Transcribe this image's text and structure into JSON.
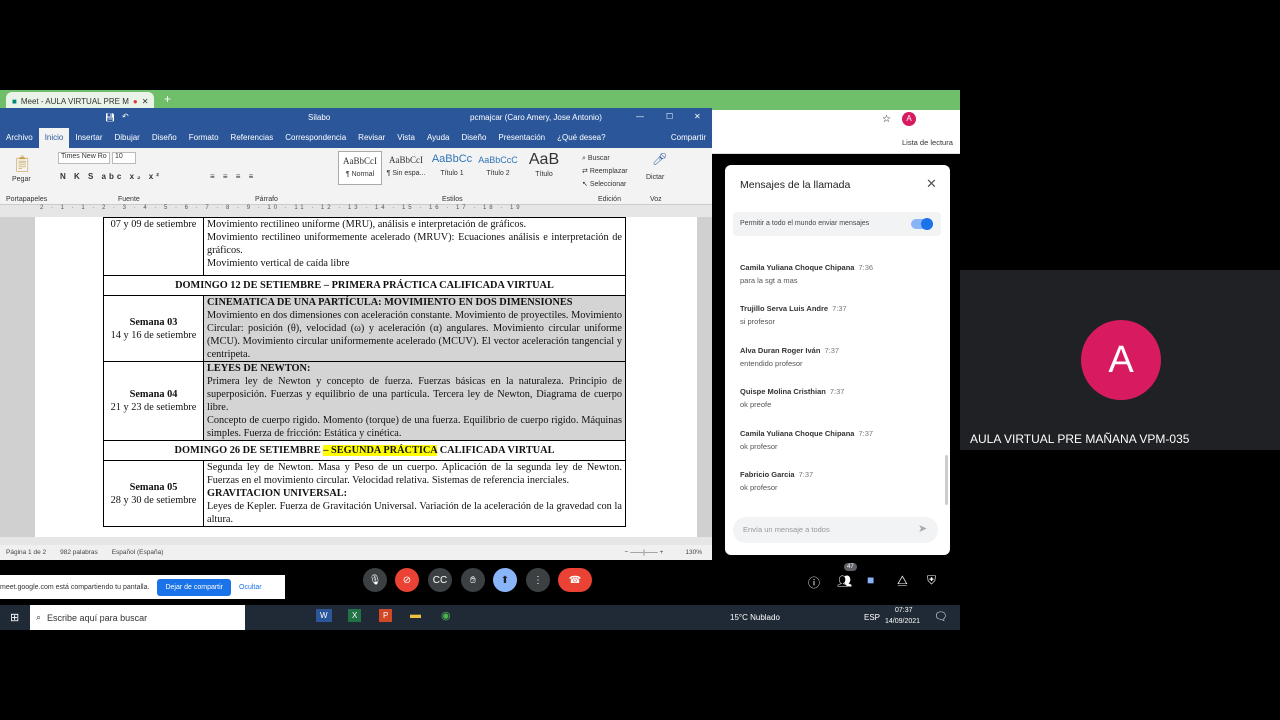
{
  "chrome": {
    "tab_title": "Meet - AULA VIRTUAL PRE M",
    "new_tab": "+",
    "reading_list": "Lista de lectura",
    "avatar_letter": "A"
  },
  "word": {
    "title": "Silabo",
    "user": "pcmajcar (Caro Amery, Jose Antonio)",
    "tabs": [
      "Archivo",
      "Inicio",
      "Insertar",
      "Dibujar",
      "Diseño",
      "Formato",
      "Referencias",
      "Correspondencia",
      "Revisar",
      "Vista",
      "Ayuda",
      "Diseño",
      "Presentación",
      "¿Qué desea?"
    ],
    "share": "Compartir",
    "font": "Times New Ro",
    "size": "10",
    "paste": "Pegar",
    "styles": [
      {
        "preview": "AaBbCcI",
        "label": "¶ Normal"
      },
      {
        "preview": "AaBbCcI",
        "label": "¶ Sin espa..."
      },
      {
        "preview": "AaBbCc",
        "label": "Título 1"
      },
      {
        "preview": "AaBbCcC",
        "label": "Título 2"
      },
      {
        "preview": "AaB",
        "label": "Título"
      }
    ],
    "edit": [
      "Buscar",
      "Reemplazar",
      "Seleccionar"
    ],
    "dictate": "Dictar",
    "groups": [
      "Portapapeles",
      "Fuente",
      "Párrafo",
      "Estilos",
      "Edición",
      "Voz"
    ],
    "ruler": "2 · 1 · 1 · 2 · 3 · 4 · 5 · 6 · 7 · 8 · 9 · 10 · 11 · 12 · 13 · 14 · 15 · 16 · 17 · 18 · 19",
    "status": {
      "page": "Página 1 de 2",
      "words": "982 palabras",
      "lang": "Español (España)",
      "zoom": "130%"
    }
  },
  "document": {
    "rows": [
      {
        "date": "07 y 09 de setiembre",
        "lines": [
          "Movimiento rectilineo uniforme (MRU), análisis e interpretación de gráficos.",
          "Movimiento rectilineo uniformemente acelerado (MRUV): Ecuaciones análisis e interpretación de gráficos.",
          "Movimiento vertical de caída libre"
        ]
      },
      {
        "header": "DOMINGO 12 DE SETIEMBRE – PRIMERA PRÁCTICA CALIFICADA VIRTUAL"
      },
      {
        "week": "Semana 03",
        "date": "14 y 16 de setiembre",
        "title": "CINEMATICA DE UNA PARTÍCULA: MOVIMIENTO EN DOS DIMENSIONES",
        "text": "Movimiento en dos dimensiones con aceleración constante. Movimiento de proyectiles. Movimiento Circular: posición (θ), velocidad (ω) y aceleración (α) angulares. Movimiento circular uniforme (MCU). Movimiento circular uniformemente acelerado (MCUV). El vector aceleración tangencial y centripeta."
      },
      {
        "week": "Semana 04",
        "date": "21 y 23 de setiembre",
        "title": "LEYES DE NEWTON:",
        "text": "Primera ley de Newton y concepto de fuerza. Fuerzas básicas en la naturaleza. Principio de superposición. Fuerzas y equilibrio de una partícula. Tercera ley de Newton, Diagrama de cuerpo libre.",
        "text2": "Concepto de cuerpo rigido. Momento (torque) de una fuerza. Equilibrio de cuerpo rigido. Máquinas simples. Fuerza de fricción: Estática y cinética."
      },
      {
        "header_a": "DOMINGO 26 DE SETIEMBRE ",
        "header_b": "– SEGUNDA PRÁCTICA",
        "header_c": " CALIFICADA VIRTUAL"
      },
      {
        "week": "Semana 05",
        "date": "28 y 30 de setiembre",
        "text": "Segunda ley de Newton. Masa y Peso de un cuerpo. Aplicación de la segunda ley de Newton. Fuerzas en el movimiento circular. Velocidad relativa. Sistemas de referencia inerciales.",
        "title": "GRAVITACION UNIVERSAL:",
        "text2": "Leyes de Kepler. Fuerza de Gravitación Universal. Variación de la aceleración de la gravedad con la altura."
      }
    ]
  },
  "chat": {
    "title": "Mensajes de la llamada",
    "toggle_label": "Permitir a todo el mundo enviar mensajes",
    "toggle_on": true,
    "placeholder": "Envía un mensaje a todos",
    "messages": [
      {
        "name": "Camila Yuliana Choque Chipana",
        "time": "7:36",
        "text": "para la sgt a mas"
      },
      {
        "name": "Trujillo Serva Luis Andre",
        "time": "7:37",
        "text": "si profesor"
      },
      {
        "name": "Alva Duran Roger Iván",
        "time": "7:37",
        "text": "entendido profesor"
      },
      {
        "name": "Quispe Molina Cristhian",
        "time": "7:37",
        "text": "ok preofe"
      },
      {
        "name": "Camila Yuliana Choque Chipana",
        "time": "7:37",
        "text": "ok profesor"
      },
      {
        "name": "Fabricio Garcia",
        "time": "7:37",
        "text": "ok profesor"
      }
    ]
  },
  "tile": {
    "letter": "A",
    "name": "AULA VIRTUAL PRE MAÑANA VPM-035",
    "color": "#d81b60"
  },
  "meet": {
    "participants": "47",
    "notice": "meet.google.com está compartiendo tu pantalla.",
    "stop": "Dejar de compartir",
    "hide": "Ocultar"
  },
  "taskbar": {
    "search": "Escribe aquí para buscar",
    "weather": "15°C Nublado",
    "lang": "ESP",
    "time": "07:37",
    "date": "14/09/2021"
  }
}
